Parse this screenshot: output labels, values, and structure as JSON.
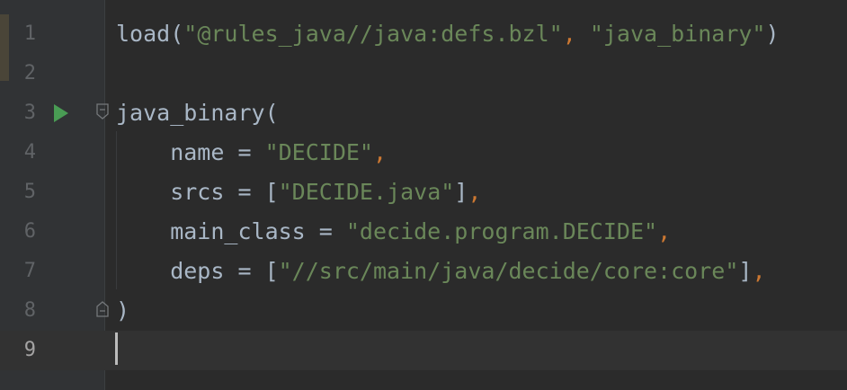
{
  "editor": {
    "lines": [
      {
        "number": "1",
        "tokens": [
          {
            "text": "load(",
            "kind": "punct"
          },
          {
            "text": "\"@rules_java//java:defs.bzl\"",
            "kind": "str"
          },
          {
            "text": ", ",
            "kind": "comma"
          },
          {
            "text": "\"java_binary\"",
            "kind": "str"
          },
          {
            "text": ")",
            "kind": "punct"
          }
        ]
      },
      {
        "number": "2",
        "tokens": []
      },
      {
        "number": "3",
        "tokens": [
          {
            "text": "java_binary(",
            "kind": "punct"
          }
        ]
      },
      {
        "number": "4",
        "tokens": [
          {
            "text": "    name = ",
            "kind": "ident"
          },
          {
            "text": "\"DECIDE\"",
            "kind": "str"
          },
          {
            "text": ",",
            "kind": "comma"
          }
        ]
      },
      {
        "number": "5",
        "tokens": [
          {
            "text": "    srcs = [",
            "kind": "ident"
          },
          {
            "text": "\"DECIDE.java\"",
            "kind": "str"
          },
          {
            "text": "]",
            "kind": "punct"
          },
          {
            "text": ",",
            "kind": "comma"
          }
        ]
      },
      {
        "number": "6",
        "tokens": [
          {
            "text": "    main_class = ",
            "kind": "ident"
          },
          {
            "text": "\"decide.program.DECIDE\"",
            "kind": "str"
          },
          {
            "text": ",",
            "kind": "comma"
          }
        ]
      },
      {
        "number": "7",
        "tokens": [
          {
            "text": "    deps = [",
            "kind": "ident"
          },
          {
            "text": "\"//src/main/java/decide/core:core\"",
            "kind": "str"
          },
          {
            "text": "]",
            "kind": "punct"
          },
          {
            "text": ",",
            "kind": "comma"
          }
        ]
      },
      {
        "number": "8",
        "tokens": [
          {
            "text": ")",
            "kind": "punct"
          }
        ]
      },
      {
        "number": "9",
        "tokens": []
      }
    ],
    "icons": {
      "run": "run-icon",
      "fold_start": "fold-start-icon",
      "fold_end": "fold-end-icon"
    },
    "colors": {
      "background": "#2b2b2b",
      "gutter": "#313335",
      "string": "#6a8759",
      "comma": "#cc7832",
      "default": "#a9b7c6",
      "line_number": "#606366",
      "run_icon": "#499c54"
    }
  }
}
